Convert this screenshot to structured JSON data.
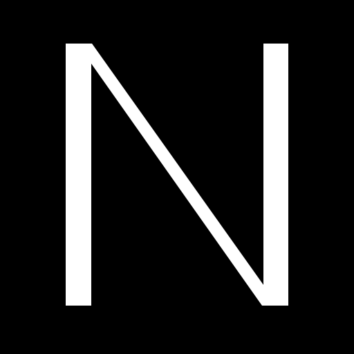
{
  "logo": {
    "letter": "N",
    "background_color": "#000000",
    "letter_color": "#ffffff"
  }
}
